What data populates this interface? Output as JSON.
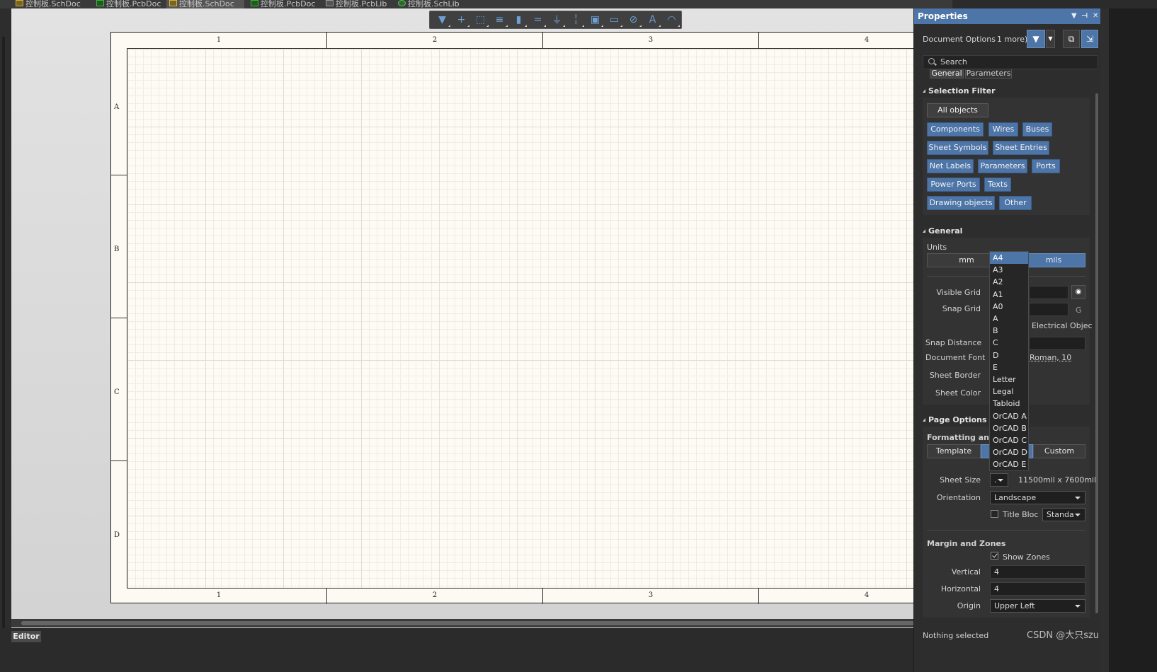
{
  "tabs": [
    {
      "label": "控制板.SchDoc",
      "active": false
    },
    {
      "label": "控制板.PcbDoc",
      "active": false
    },
    {
      "label": "控制板.SchDoc",
      "active": true
    },
    {
      "label": "控制板.PcbDoc",
      "active": false
    },
    {
      "label": "控制板.PcbLib",
      "active": false
    },
    {
      "label": "控制板.SchLib",
      "active": false
    }
  ],
  "toolbar": {
    "icons": [
      "filter-icon",
      "cross-probe-icon",
      "select-rect-icon",
      "align-icon",
      "component-icon",
      "wire-icon",
      "power-port-icon",
      "bus-icon",
      "sheet-symbol-icon",
      "port-icon",
      "no-erc-icon",
      "text-icon",
      "arc-icon"
    ],
    "glyphs": [
      "▼",
      "+",
      "⬚",
      "≡",
      "▮",
      "≈",
      "⏚",
      "╎",
      "▣",
      "▭",
      "⊘",
      "A",
      "◠"
    ]
  },
  "sheet": {
    "zone_columns": [
      "1",
      "2",
      "3",
      "4"
    ],
    "zone_rows": [
      "A",
      "B",
      "C",
      "D"
    ]
  },
  "panel": {
    "title": "Properties",
    "document_options": "Document Options",
    "more": "1 more)",
    "search_placeholder": "Search",
    "subtabs": [
      "General",
      "Parameters"
    ],
    "selection_filter": {
      "header": "Selection Filter",
      "all_objects": "All objects",
      "chips": [
        "Components",
        "Wires",
        "Buses",
        "Sheet Symbols",
        "Sheet Entries",
        "Net Labels",
        "Parameters",
        "Ports",
        "Power Ports",
        "Texts",
        "Drawing objects",
        "Other"
      ]
    },
    "general": {
      "header": "General",
      "units_label": "Units",
      "unit_mm": "mm",
      "unit_mils": "mils",
      "selected_unit": "mils",
      "visible_grid_label": "Visible Grid",
      "snap_grid_label": "Snap Grid",
      "snap_grid_hotkey": "G",
      "electrical_objects": "Electrical Objec",
      "snap_distance_label": "Snap Distance",
      "document_font_label": "Document Font",
      "document_font_value": "Roman, 10",
      "sheet_border_label": "Sheet Border",
      "sheet_color_label": "Sheet Color"
    },
    "page_options": {
      "header": "Page Options",
      "formatting_label": "Formatting and Si",
      "template_label": "Template",
      "custom_label": "Custom",
      "sheet_size_label": "Sheet Size",
      "sheet_size_value": ".",
      "sheet_size_dims": "11500mil x 7600mil",
      "orientation_label": "Orientation",
      "orientation_value": "Landscape",
      "title_block_label": "Title Bloc",
      "title_block_checked": false,
      "title_block_style": "Standa"
    },
    "margin_zones": {
      "header": "Margin and Zones",
      "show_zones_label": "Show Zones",
      "show_zones_checked": true,
      "vertical_label": "Vertical",
      "vertical_value": "4",
      "horizontal_label": "Horizontal",
      "horizontal_value": "4",
      "origin_label": "Origin",
      "origin_value": "Upper Left"
    },
    "status": "Nothing selected"
  },
  "sheet_size_options": [
    "A4",
    "A3",
    "A2",
    "A1",
    "A0",
    "A",
    "B",
    "C",
    "D",
    "E",
    "Letter",
    "Legal",
    "Tabloid",
    "OrCAD A",
    "OrCAD B",
    "OrCAD C",
    "OrCAD D",
    "OrCAD E"
  ],
  "sheet_size_selected": "A4",
  "editor_tab": "Editor",
  "watermark": "CSDN @大只szu",
  "colors": {
    "accent": "#4d75a8",
    "panel_bg": "#2d2d2d",
    "sheet_bg": "#fcfaf2"
  }
}
